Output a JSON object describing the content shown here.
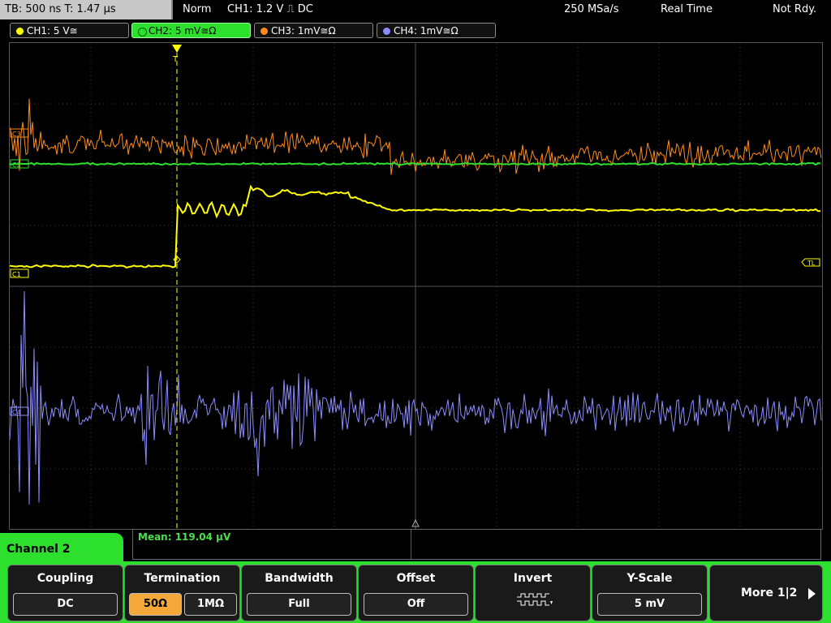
{
  "topbar": {
    "timebase": "TB: 500 ns  T: 1.47 µs",
    "mode": "Norm",
    "trigger": "CH1: 1.2 V ⎍ DC",
    "sample_rate": "250 MSa/s",
    "acq": "Real Time",
    "status": "Not Rdy."
  },
  "channels": [
    {
      "label": "CH1: 5 V≅",
      "color": "#ffff00"
    },
    {
      "label": "CH2: 5 mV≅Ω",
      "color": "#2ee02e"
    },
    {
      "label": "CH3: 1mV≅Ω",
      "color": "#ff8c1a"
    },
    {
      "label": "CH4: 1mV≅Ω",
      "color": "#8c8cff"
    }
  ],
  "markers": {
    "c3": "C3",
    "c2": "C2",
    "c1": "C1",
    "c4": "C4",
    "tl": "TL",
    "trig": "T"
  },
  "measurement": {
    "mean": "Mean: 119.04 µV"
  },
  "panel": {
    "channel": "Channel 2"
  },
  "softkeys": {
    "coupling": {
      "title": "Coupling",
      "value": "DC"
    },
    "termination": {
      "title": "Termination",
      "opt1": "50Ω",
      "opt2": "1MΩ"
    },
    "bandwidth": {
      "title": "Bandwidth",
      "value": "Full"
    },
    "offset": {
      "title": "Offset",
      "value": "Off"
    },
    "invert": {
      "title": "Invert"
    },
    "yscale": {
      "title": "Y-Scale",
      "value": "5 mV"
    },
    "more": {
      "title": "More 1|2"
    }
  },
  "colors": {
    "accent": "#2ee02e",
    "grid": "#3a3a3a"
  }
}
